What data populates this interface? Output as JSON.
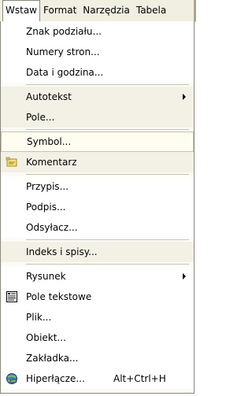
{
  "menubar": {
    "items": [
      {
        "label": "Wstaw",
        "active": true
      },
      {
        "label": "Format",
        "active": false
      },
      {
        "label": "Narzędzia",
        "active": false
      },
      {
        "label": "Tabela",
        "active": false
      }
    ]
  },
  "menu": {
    "items": [
      {
        "label": "Znak podziału...",
        "key": "znak-podzialu"
      },
      {
        "label": "Numery stron...",
        "key": "numery-stron"
      },
      {
        "label": "Data i godzina...",
        "key": "data-i-godzina"
      },
      {
        "label": "Autotekst",
        "key": "autotekst",
        "submenu": true
      },
      {
        "label": "Pole...",
        "key": "pole"
      },
      {
        "label": "Symbol...",
        "key": "symbol",
        "highlight": true
      },
      {
        "label": "Komentarz",
        "key": "komentarz",
        "icon": "comment-icon"
      },
      {
        "label": "Przypis...",
        "key": "przypis"
      },
      {
        "label": "Podpis...",
        "key": "podpis"
      },
      {
        "label": "Odsyłacz...",
        "key": "odsylacz"
      },
      {
        "label": "Indeks i spisy...",
        "key": "indeks-i-spisy"
      },
      {
        "label": "Rysunek",
        "key": "rysunek",
        "submenu": true
      },
      {
        "label": "Pole tekstowe",
        "key": "pole-tekstowe",
        "icon": "textbox-icon"
      },
      {
        "label": "Plik...",
        "key": "plik"
      },
      {
        "label": "Obiekt...",
        "key": "obiekt"
      },
      {
        "label": "Zakładka...",
        "key": "zakladka"
      },
      {
        "label": "Hiperłącze...",
        "key": "hiperlacze",
        "icon": "hyperlink-icon",
        "shortcut": "Alt+Ctrl+H"
      }
    ]
  }
}
